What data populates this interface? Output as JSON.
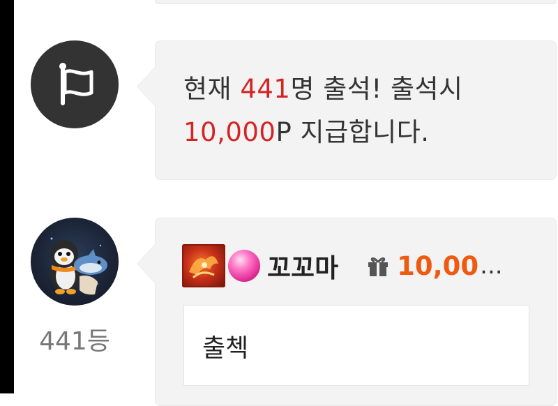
{
  "notice": {
    "prefix": "현재 ",
    "count": "441",
    "mid": "명 출석! 출석시",
    "reward": "10,000",
    "suffix": "P 지급합니다."
  },
  "entry": {
    "rank_label": "441등",
    "nickname": "꼬꼬마",
    "points": "10,00",
    "points_ellipsis": "...",
    "comment": "출첵"
  },
  "colors": {
    "highlight_red": "#d42424",
    "points_orange": "#ee5a12",
    "flag_avatar_bg": "#333333"
  },
  "icons": {
    "notice_avatar": "flag-icon",
    "gift": "gift-icon",
    "gem": "gem-icon"
  }
}
